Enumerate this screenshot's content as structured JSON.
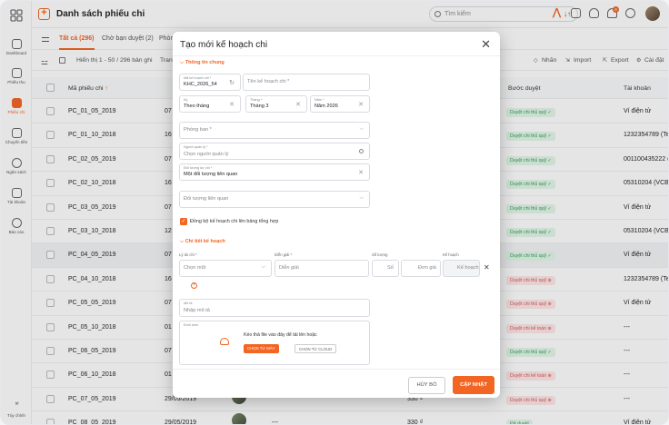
{
  "app": {
    "title": "Danh sách phiếu chi",
    "search_placeholder": "Tìm kiếm",
    "notif_count": "8"
  },
  "sidebar": [
    {
      "label": "Dashboard"
    },
    {
      "label": "Phiếu thu"
    },
    {
      "label": "Phiếu chi"
    },
    {
      "label": "Chuyển tiền"
    },
    {
      "label": "Ngân sách"
    },
    {
      "label": "Tài khoản"
    },
    {
      "label": "Báo cáo"
    },
    {
      "label": "Tùy chỉnh"
    }
  ],
  "tabs": [
    "Tất cả (296)",
    "Chờ bạn duyệt (2)",
    "Phòn"
  ],
  "toolbar": {
    "range": "Hiển thị 1 - 50 / 296 bản ghi",
    "trang": "Trang",
    "nhan": "Nhãn",
    "import": "Import",
    "export": "Export",
    "settings": "Cài đặt"
  },
  "table": {
    "headers": {
      "code": "Mã phiếu chi",
      "step": "Bước duyệt",
      "account": "Tài khoản"
    },
    "rows": [
      {
        "code": "PC_01_05_2019",
        "date": "07",
        "step": "Duyệt chi thủ quỹ ✓",
        "status": "g",
        "account": "Ví điện tử"
      },
      {
        "code": "PC_01_10_2018",
        "date": "16",
        "step": "Duyệt chi thủ quỹ ✓",
        "status": "g",
        "account": "1232354789 (Te"
      },
      {
        "code": "PC_02_05_2019",
        "date": "07",
        "step": "Duyệt chi thủ quỹ ✓",
        "status": "g",
        "account": "001100435222 ("
      },
      {
        "code": "PC_02_10_2018",
        "date": "16",
        "step": "Duyệt chi thủ quỹ ✓",
        "status": "g",
        "account": "05310204 (VCB)"
      },
      {
        "code": "PC_03_05_2019",
        "date": "07",
        "step": "Duyệt chi thủ quỹ ✓",
        "status": "g",
        "account": "Ví điện tử"
      },
      {
        "code": "PC_03_10_2018",
        "date": "12",
        "step": "Duyệt chi thủ quỹ ✓",
        "status": "g",
        "account": "05310204 (VCB)"
      },
      {
        "code": "PC_04_05_2019",
        "date": "07",
        "step": "Duyệt chi thủ quỹ ✓",
        "status": "g",
        "account": "Ví điện tử"
      },
      {
        "code": "PC_04_10_2018",
        "date": "16",
        "step": "Duyệt chi thủ quỹ ⊗",
        "status": "r",
        "account": "1232354789 (Te"
      },
      {
        "code": "PC_05_05_2019",
        "date": "07",
        "step": "Duyệt chi thủ quỹ ⊗",
        "status": "r",
        "account": "Ví điện tử"
      },
      {
        "code": "PC_05_10_2018",
        "date": "01",
        "step": "Duyệt chi kế toán ⊗",
        "status": "r",
        "account": "---"
      },
      {
        "code": "PC_06_05_2019",
        "date": "07",
        "step": "Duyệt chi thủ quỹ ✓",
        "status": "g",
        "account": "---"
      },
      {
        "code": "PC_06_10_2018",
        "date": "01",
        "step": "Duyệt chi kế toán ⊗",
        "status": "r",
        "account": "---"
      },
      {
        "code": "PC_07_05_2019",
        "date": "29/05/2019",
        "step": "Duyệt chi thủ quỹ ⊗",
        "status": "r",
        "account": "---",
        "amount": "330 ₫"
      },
      {
        "code": "PC_08_05_2019",
        "date": "29/05/2019",
        "step": "Đã duyệt",
        "status": "g",
        "account": "Ví điện tử",
        "amount": "330 ₫",
        "dash": "---"
      }
    ]
  },
  "modal": {
    "title": "Tạo mới kế hoạch chi",
    "section1": "Thông tin chung",
    "f_code_label": "Mã kế hoạch chi *",
    "f_code_value": "KHC_2026_54",
    "f_name_ph": "Tên kế hoạch chi *",
    "f_period_label": "Kỳ",
    "f_period_value": "Theo tháng",
    "f_month_label": "Tháng *",
    "f_month_value": "Tháng 3",
    "f_year_label": "Năm *",
    "f_year_value": "Năm 2026",
    "f_dept_ph": "Phòng ban *",
    "f_manager_label": "Người quản lý *",
    "f_manager_ph": "Chọn người quản lý",
    "f_subject_label": "Đối tượng dự chi *",
    "f_subject_value": "Một đối tượng liên quan",
    "f_related_ph": "Đối tượng liên quan",
    "sync_label": "Đồng bộ kế hoạch chi lên bảng tổng hợp",
    "section2": "Chi tiết kế hoạch",
    "col_reason": "Lý do chi *",
    "col_desc": "Diễn giải *",
    "col_qty": "Số lượng",
    "col_plan": "Kế hoạch",
    "reason_ph": "Chọn một",
    "desc_ph": "Diễn giải",
    "qty_unit": "Số",
    "price_ph": "Đơn giá",
    "plan_ph": "Kế hoạch",
    "note_label": "Mô tả",
    "note_ph": "Nhập mô tả",
    "upload_label": "Đính kèm",
    "upload_text": "Kéo thả file vào đây để tải lên hoặc",
    "upload_btn1": "CHỌN TỪ MÁY",
    "upload_btn2": "CHỌN TỪ CLOUD",
    "cancel": "HỦY BỎ",
    "save": "CẬP NHẬT"
  }
}
